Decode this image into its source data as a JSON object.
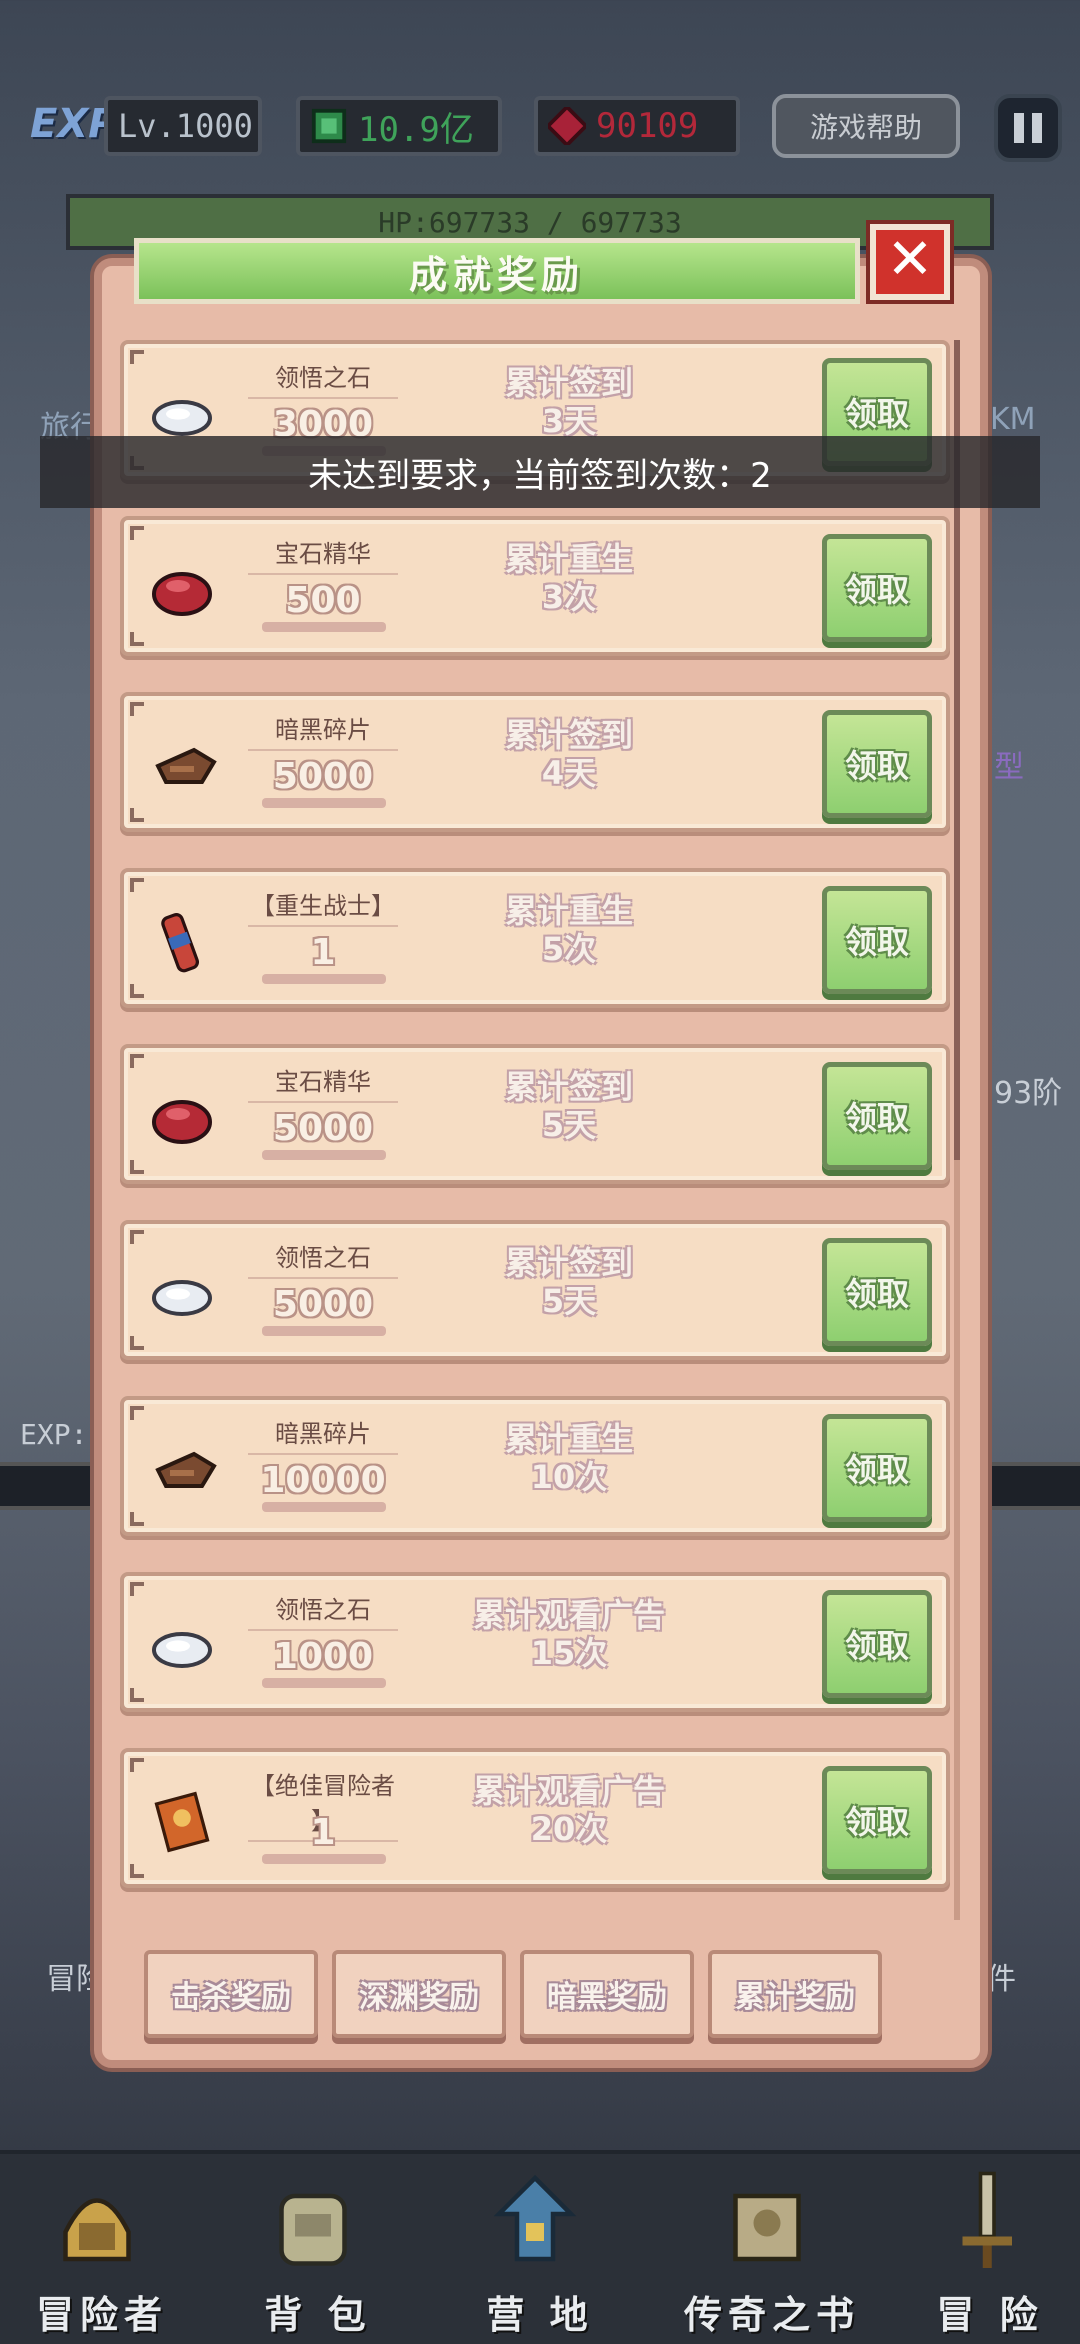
{
  "hud": {
    "exp_badge": "EXP",
    "level": "Lv.1000",
    "money": "10.9亿",
    "crystals": "90109",
    "help_label": "游戏帮助",
    "hp": "HP:697733 / 697733"
  },
  "background": {
    "exp_label": "EXP:",
    "side_text_left": "旅行",
    "side_text_right": "KM",
    "side_text_right2": "型",
    "side_text_right3": "93阶",
    "side_text_bottom_left": "冒险",
    "side_text_bottom_right": "件"
  },
  "dialog": {
    "title": "成就奖励",
    "close_label": "✕",
    "items": [
      {
        "name": "领悟之石",
        "qty": "3000",
        "cond1": "累计签到",
        "cond2": "3天",
        "btn": "领取",
        "icon": "white-stone-icon"
      },
      {
        "name": "宝石精华",
        "qty": "500",
        "cond1": "累计重生",
        "cond2": "3次",
        "btn": "领取",
        "icon": "red-gem-icon"
      },
      {
        "name": "暗黑碎片",
        "qty": "5000",
        "cond1": "累计签到",
        "cond2": "4天",
        "btn": "领取",
        "icon": "dark-shard-icon"
      },
      {
        "name": "【重生战士】",
        "qty": "1",
        "cond1": "累计重生",
        "cond2": "5次",
        "btn": "领取",
        "icon": "scroll-icon"
      },
      {
        "name": "宝石精华",
        "qty": "5000",
        "cond1": "累计签到",
        "cond2": "5天",
        "btn": "领取",
        "icon": "red-gem-icon"
      },
      {
        "name": "领悟之石",
        "qty": "5000",
        "cond1": "累计签到",
        "cond2": "5天",
        "btn": "领取",
        "icon": "white-stone-icon"
      },
      {
        "name": "暗黑碎片",
        "qty": "10000",
        "cond1": "累计重生",
        "cond2": "10次",
        "btn": "领取",
        "icon": "dark-shard-icon"
      },
      {
        "name": "领悟之石",
        "qty": "1000",
        "cond1": "累计观看广告",
        "cond2": "15次",
        "btn": "领取",
        "icon": "white-stone-icon"
      },
      {
        "name": "【绝佳冒险者",
        "name2": "】",
        "qty": "1",
        "cond1": "累计观看广告",
        "cond2": "20次",
        "btn": "领取",
        "icon": "card-icon"
      }
    ],
    "tabs": [
      "击杀奖励",
      "深渊奖励",
      "暗黑奖励",
      "累计奖励"
    ]
  },
  "toast": "未达到要求，当前签到次数：2",
  "bottom_nav": [
    "冒险者",
    "背 包",
    "营 地",
    "传奇之书",
    "冒 险"
  ],
  "colors": {
    "dialog_bg": "#e7bba8",
    "row_bg": "#f6ddc4",
    "claim_green": "#8ecf70",
    "title_green": "#7bc15a",
    "close_red": "#d0322c"
  }
}
